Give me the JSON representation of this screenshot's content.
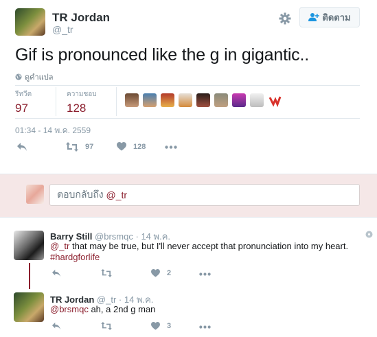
{
  "tweet": {
    "author_name": "TR Jordan",
    "author_handle": "@_tr",
    "follow_label": "ติดตาม",
    "text": "Gif is pronounced like the g in gigantic..",
    "translate_label": "ดูคำแปล",
    "stats": {
      "retweets_label": "รีทวีต",
      "retweets_value": "97",
      "likes_label": "ความชอบ",
      "likes_value": "128"
    },
    "timestamp": "01:34 - 14 พ.ค. 2559",
    "actions": {
      "retweet_count": "97",
      "like_count": "128"
    }
  },
  "reply_box": {
    "prefix": "ตอบกลับถึง",
    "mention": "@_tr"
  },
  "replies": [
    {
      "author_name": "Barry Still",
      "author_handle": "@brsmqc",
      "time": "· 14 พ.ค.",
      "mention": "@_tr",
      "text": " that may be true, but I'll never accept that pronunciation into my heart.",
      "hashtag": "#hardgforlife",
      "like_count": "2"
    },
    {
      "author_name": "TR Jordan",
      "author_handle": "@_tr",
      "time": "· 14 พ.ค.",
      "mention": "@brsmqc",
      "text": " ah, a 2nd g man",
      "like_count": "3"
    }
  ],
  "colors": {
    "accent": "#8b1e2d",
    "muted": "#8899a6",
    "reply_bg": "#f5e7e7"
  },
  "icons": [
    "gear-icon",
    "follow-person-icon",
    "globe-icon",
    "reply-icon",
    "retweet-icon",
    "heart-icon",
    "more-icon",
    "more-circle-icon"
  ]
}
